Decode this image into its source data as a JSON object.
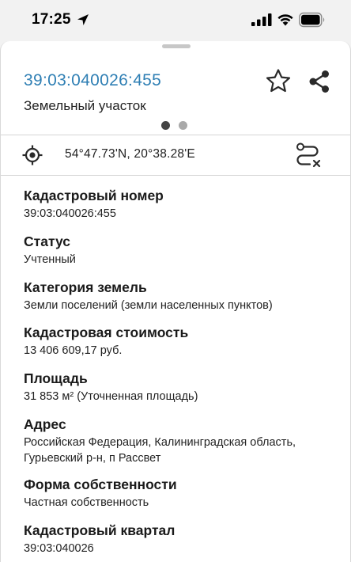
{
  "status_bar": {
    "time": "17:25",
    "icons": [
      "location-arrow-icon",
      "signal-icon",
      "wifi-icon",
      "battery-icon"
    ]
  },
  "header": {
    "cadastral_id": "39:03:040026:455",
    "object_type": "Земельный участок",
    "actions": [
      "star-icon",
      "share-icon"
    ],
    "page_indicator": {
      "count": 2,
      "active": 1
    }
  },
  "coordinates": {
    "text": "54°47.73'N, 20°38.28'E",
    "left_icon": "crosshair-icon",
    "right_icon": "route-clear-icon"
  },
  "details": [
    {
      "label": "Кадастровый номер",
      "value": "39:03:040026:455"
    },
    {
      "label": "Статус",
      "value": "Учтенный"
    },
    {
      "label": "Категория земель",
      "value": "Земли поселений (земли населенных пунктов)"
    },
    {
      "label": "Кадастровая стоимость",
      "value": "13 406 609,17 руб."
    },
    {
      "label": "Площадь",
      "value": "31 853 м² (Уточненная площадь)"
    },
    {
      "label": "Адрес",
      "value": "Российская Федерация, Калининградская область, Гурьевский р-н, п Рассвет"
    },
    {
      "label": "Форма собственности",
      "value": "Частная собственность"
    },
    {
      "label": "Кадастровый квартал",
      "value": "39:03:040026"
    }
  ],
  "colors": {
    "accent": "#2f7fb4",
    "background": "#f2f2f2",
    "sheet": "#ffffff"
  }
}
